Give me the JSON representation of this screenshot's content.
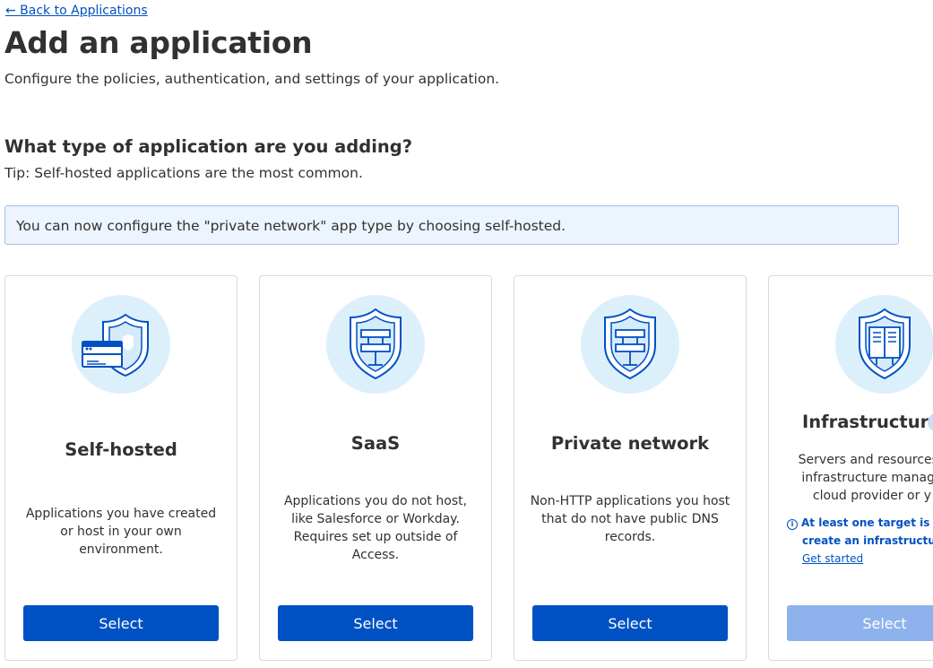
{
  "header": {
    "back_link": "← Back to Applications",
    "title": "Add an application",
    "subtitle": "Configure the policies, authentication, and settings of your application."
  },
  "section": {
    "title": "What type of application are you adding?",
    "tip": "Tip: Self-hosted applications are the most common.",
    "banner": "You can now configure the \"private network\" app type by choosing self-hosted."
  },
  "cards": [
    {
      "title": "Self-hosted",
      "description": "Applications you have created or host in your own environment.",
      "button": "Select",
      "icon": "shield-server-icon"
    },
    {
      "title": "SaaS",
      "description": "Applications you do not host, like Salesforce or Workday. Requires set up outside of Access.",
      "button": "Select",
      "icon": "shield-network-icon"
    },
    {
      "title": "Private network",
      "description": "Non-HTTP applications you host that do not have public DNS records.",
      "button": "Select",
      "icon": "shield-network-icon"
    },
    {
      "title": "Infrastructure",
      "description": "Servers and resources i infrastructure manage cloud provider or y",
      "warning_line1": "At least one target is requ",
      "warning_line2": "create an infrastructure a",
      "warning_link": "Get started",
      "button": "Select",
      "icon": "shield-servers-icon",
      "disabled": true
    }
  ],
  "colors": {
    "accent": "#0051c3",
    "accent_disabled": "#8eb3ec",
    "icon_bg": "#dcf0fb",
    "banner_bg": "#ecf4fd",
    "text": "#313131"
  }
}
